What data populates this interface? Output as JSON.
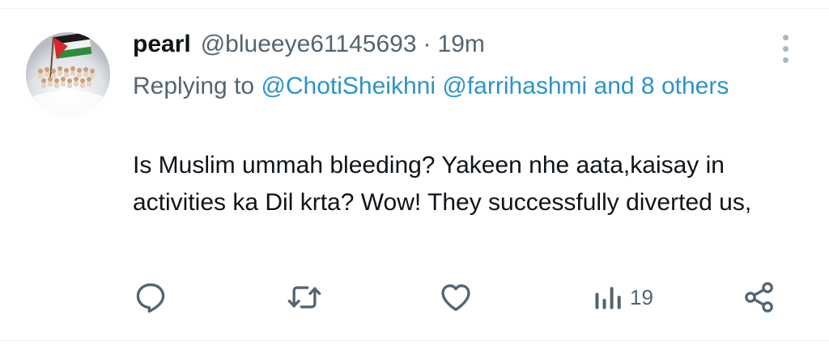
{
  "tweet": {
    "display_name": "pearl",
    "handle": "@blueeye61145693",
    "separator": "·",
    "time": "19m",
    "replying_prefix": "Replying to ",
    "mention_1": "@ChotiSheikhni",
    "mention_2": "@farrihashmi",
    "others": "and 8 others",
    "text": "Is Muslim ummah bleeding? Yakeen nhe aata,kaisay in activities ka Dil krta? Wow! They successfully diverted us,"
  },
  "actions": {
    "reply_icon": "reply-icon",
    "retweet_icon": "retweet-icon",
    "like_icon": "heart-icon",
    "views_icon": "views-icon",
    "views_count": "19",
    "share_icon": "share-icon"
  },
  "colors": {
    "accent": "#2d93c9",
    "secondary_text": "#536471",
    "primary_text": "#0f1419"
  }
}
